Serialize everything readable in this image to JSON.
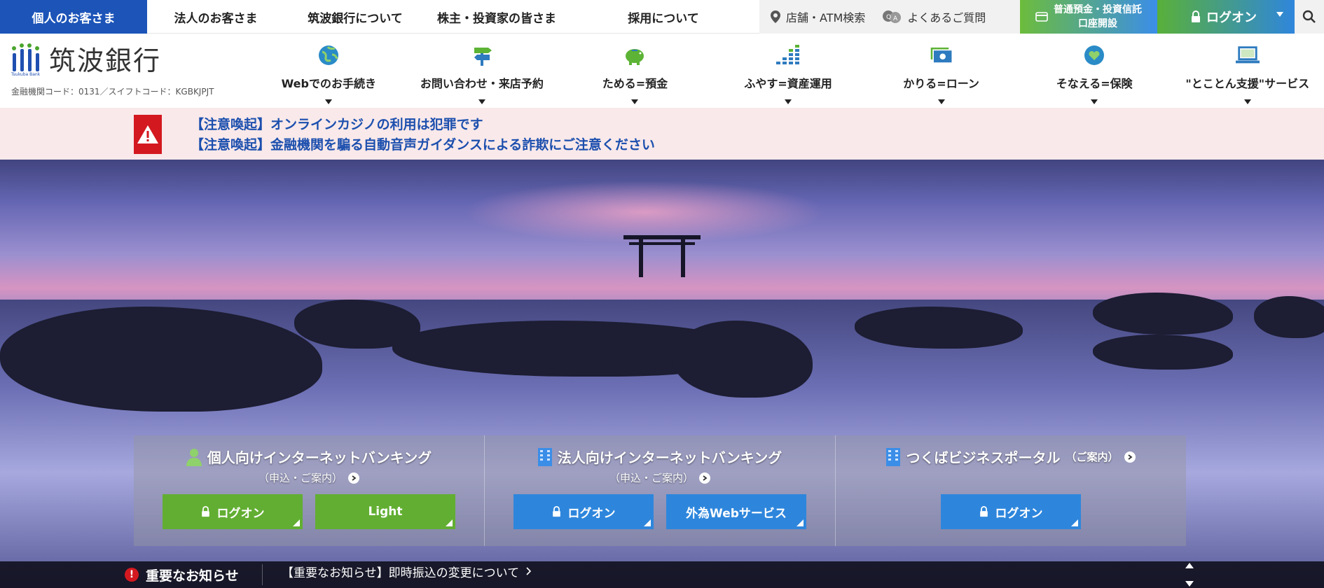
{
  "topbar": {
    "active": "個人のお客さま",
    "items": [
      "法人のお客さま",
      "筑波銀行について",
      "株主・投資家の皆さま",
      "採用について"
    ],
    "store_search": "店舗・ATM検索",
    "faq": "よくあるご質問",
    "account_open_line1": "普通預金・投資信託",
    "account_open_line2": "口座開設",
    "logon": "ログオン"
  },
  "header": {
    "logo_text": "筑波銀行",
    "logo_sub": "Tsukuba Bank",
    "bank_code": "金融機関コード：0131／スイフトコード：KGBKJPJT"
  },
  "gnav": [
    {
      "label": "Webでのお手続き",
      "icon": "globe-icon"
    },
    {
      "label": "お問い合わせ・来店予約",
      "icon": "signpost-icon"
    },
    {
      "label": "ためる=預金",
      "icon": "piggy-bank-icon"
    },
    {
      "label": "ふやす=資産運用",
      "icon": "growth-chart-icon"
    },
    {
      "label": "かりる=ローン",
      "icon": "banknote-icon"
    },
    {
      "label": "そなえる=保険",
      "icon": "heart-shield-icon"
    },
    {
      "label": "\"とことん支援\"サービス",
      "icon": "laptop-icon"
    }
  ],
  "alert": {
    "links": [
      "【注意喚起】オンラインカジノの利用は犯罪です",
      "【注意喚起】金融機関を騙る自動音声ガイダンスによる詐欺にご注意ください"
    ]
  },
  "banking": {
    "personal": {
      "title": "個人向けインターネットバンキング",
      "sub": "（申込・ご案内）",
      "btn_logon": "ログオン",
      "btn_light": "Light"
    },
    "corporate": {
      "title": "法人向けインターネットバンキング",
      "sub": "（申込・ご案内）",
      "btn_logon": "ログオン",
      "btn_fx": "外為Webサービス"
    },
    "portal": {
      "title": "つくばビジネスポータル",
      "title_small": "（ご案内）",
      "btn_logon": "ログオン"
    }
  },
  "news": {
    "label": "重要なお知らせ",
    "item": "【重要なお知らせ】即時振込の変更について"
  },
  "colors": {
    "brand_blue": "#1c54b8",
    "green": "#62ae32",
    "blue": "#2e86dc",
    "alert_red": "#d3181f",
    "link_blue": "#1c4fae"
  }
}
